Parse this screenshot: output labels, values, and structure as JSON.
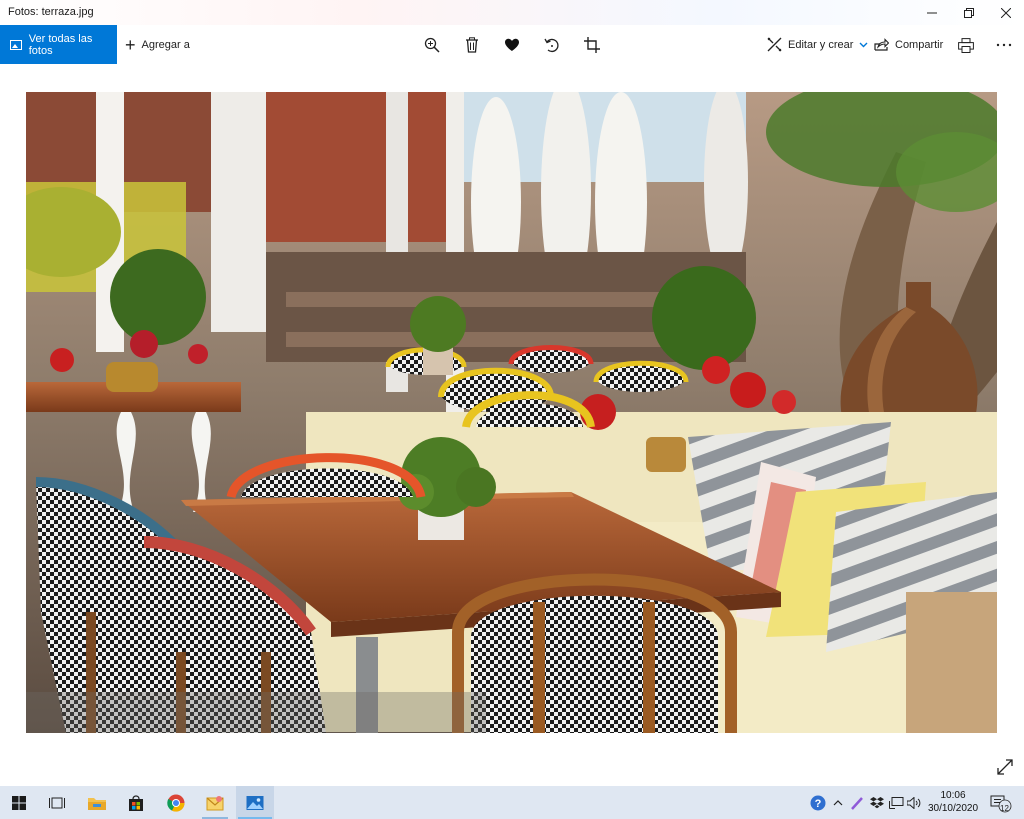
{
  "window": {
    "title": "Fotos: terraza.jpg",
    "controls": [
      "minimize-icon",
      "maximize-icon",
      "close-icon"
    ]
  },
  "toolbar": {
    "view_all_label": "Ver todas las fotos",
    "add_to_label": "Agregar a",
    "center_tools": [
      "zoom-in-icon",
      "delete-icon",
      "favorite-icon",
      "rotate-icon",
      "crop-icon"
    ],
    "edit_create_label": "Editar y crear",
    "share_label": "Compartir",
    "right_tools": [
      "print-icon",
      "more-icon"
    ]
  },
  "photo": {
    "filename": "terraza.jpg",
    "scene": "outdoor terrace with tables, rattan chairs, cushions and plants"
  },
  "taskbar": {
    "apps": [
      "start-icon",
      "task-view-icon",
      "file-explorer-icon",
      "store-icon",
      "chrome-icon",
      "mail-icon",
      "photos-icon"
    ],
    "time": "10:06",
    "date": "30/10/2020",
    "notification_count": "12"
  },
  "colors": {
    "accent": "#0078d7",
    "taskbar": "#dfe7f2"
  }
}
